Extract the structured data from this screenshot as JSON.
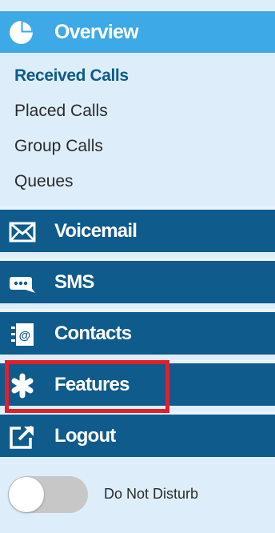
{
  "overview": {
    "label": "Overview",
    "icon": "pie-chart-icon"
  },
  "subnav": [
    {
      "label": "Received Calls",
      "active": true
    },
    {
      "label": "Placed Calls",
      "active": false
    },
    {
      "label": "Group Calls",
      "active": false
    },
    {
      "label": "Queues",
      "active": false
    }
  ],
  "menu": [
    {
      "label": "Voicemail",
      "icon": "envelope-icon"
    },
    {
      "label": "SMS",
      "icon": "chat-bubble-icon"
    },
    {
      "label": "Contacts",
      "icon": "address-book-icon"
    },
    {
      "label": "Features",
      "icon": "asterisk-icon"
    },
    {
      "label": "Logout",
      "icon": "external-link-icon"
    }
  ],
  "do_not_disturb": {
    "label": "Do Not Disturb",
    "enabled": false
  },
  "colors": {
    "overview_bg": "#3da9e6",
    "menu_bg": "#0e5b8c",
    "active_sub": "#0d5c8c",
    "highlight": "#e0202d",
    "panel_bg": "#ddeefa"
  }
}
